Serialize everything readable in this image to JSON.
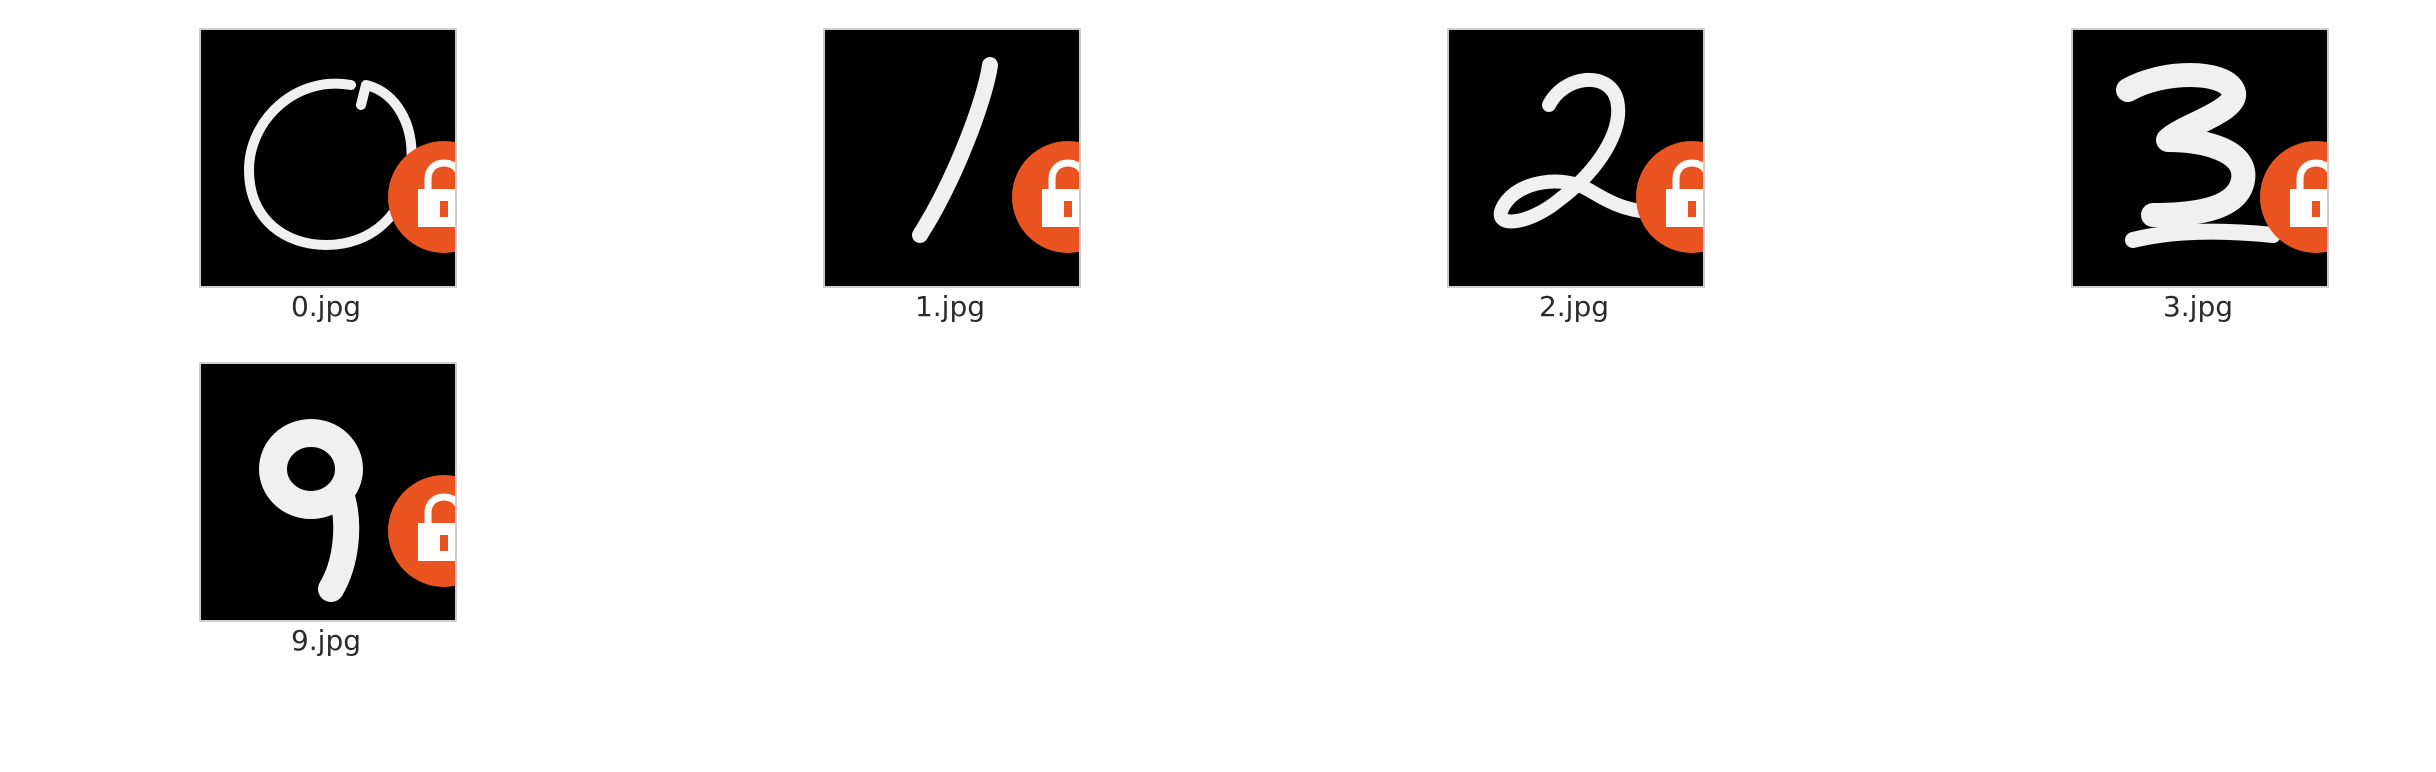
{
  "files": [
    {
      "name": "0.jpg",
      "digit": "0",
      "icon": "lock-icon"
    },
    {
      "name": "1.jpg",
      "digit": "1",
      "icon": "lock-icon"
    },
    {
      "name": "2.jpg",
      "digit": "2",
      "icon": "lock-icon"
    },
    {
      "name": "3.jpg",
      "digit": "3",
      "icon": "lock-icon"
    },
    {
      "name": "9.jpg",
      "digit": "9",
      "icon": "lock-icon"
    }
  ],
  "colors": {
    "lock_badge": "#e95420",
    "lock_symbol": "#ffffff",
    "thumbnail_bg": "#000000",
    "digit_stroke": "#f0f0f0"
  }
}
